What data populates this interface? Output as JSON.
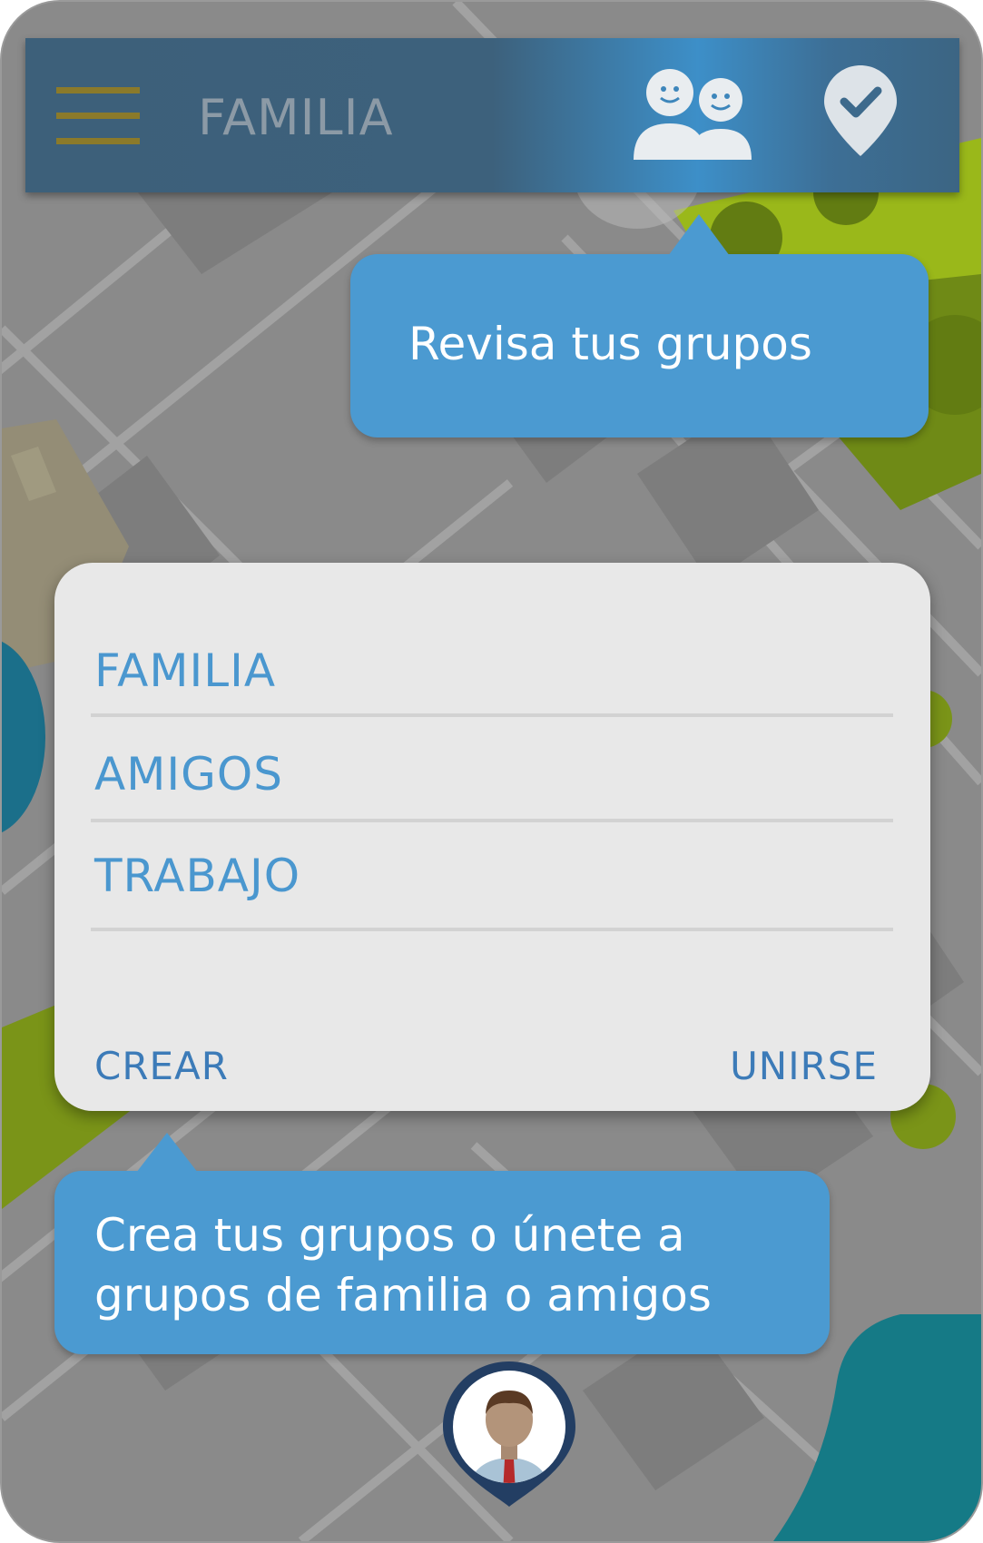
{
  "app_bar": {
    "title": "FAMILIA",
    "menu_icon": "hamburger-menu-icon",
    "group_icon": "group-icon",
    "location_icon": "location-check-icon",
    "menu_color": "#8b7a2a",
    "bar_color": "#3d617c"
  },
  "tooltips": {
    "top": "Revisa tus grupos",
    "bottom": {
      "line1": "Crea tus grupos o únete a",
      "line2": "grupos de familia o amigos"
    },
    "color": "#4b9ad1"
  },
  "dialog": {
    "groups": [
      "FAMILIA",
      "AMIGOS",
      "TRABAJO"
    ],
    "create_label": "CREAR",
    "join_label": "UNIRSE",
    "group_text_color": "#4a97cf"
  },
  "user_marker": {
    "icon": "user-avatar-pin-icon"
  }
}
